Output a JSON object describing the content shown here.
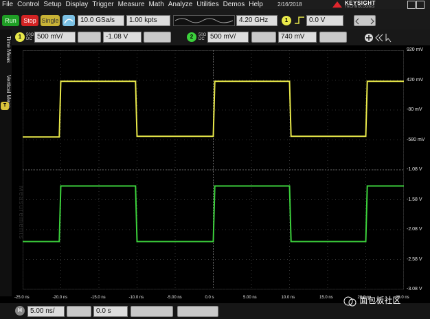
{
  "menu": [
    "File",
    "Control",
    "Setup",
    "Display",
    "Trigger",
    "Measure",
    "Math",
    "Analyze",
    "Utilities",
    "Demos",
    "Help"
  ],
  "date": "2/16/2018",
  "brand": {
    "name": "KEYSIGHT",
    "sub": "TECHNOLOGIES"
  },
  "toolbar": {
    "run": "Run",
    "stop": "Stop",
    "single": "Single",
    "sample_rate": "10.0 GSa/s",
    "memory_depth": "1.00 kpts",
    "bandwidth": "4.20 GHz",
    "trigger_source": "1",
    "trigger_level": "0.0 V"
  },
  "channels": [
    {
      "id": "1",
      "coupling": "50Ω\nDC",
      "scale": "500 mV/",
      "offset": "-1.08 V",
      "color": "#e8e84a"
    },
    {
      "id": "2",
      "coupling": "50Ω\nDC",
      "scale": "500 mV/",
      "offset": "740 mV",
      "color": "#3cd13c"
    }
  ],
  "sidebar": {
    "time_meas": "Time Meas",
    "vertical_meas": "Vertical Meas",
    "measurements": "Measurements"
  },
  "y_axis_labels": [
    "920 mV",
    "420 mV",
    "-80 mV",
    "-580 mV",
    "-1.08 V",
    "-1.58 V",
    "-2.08 V",
    "-2.58 V",
    "-3.08 V"
  ],
  "x_axis_labels": [
    "-25.0 ns",
    "-20.0 ns",
    "-15.0 ns",
    "-10.0 ns",
    "-5.00 ns",
    "0.0 s",
    "5.00 ns",
    "10.0 ns",
    "15.0 ns",
    "20.0 ns",
    "25.0 ns"
  ],
  "horizontal": {
    "badge": "H",
    "scale": "5.00 ns/",
    "delay": "0.0 s"
  },
  "watermark_text": "面包板社区",
  "chart_data": {
    "type": "line",
    "x_unit": "ns",
    "xlim": [
      -25,
      25
    ],
    "series": [
      {
        "channel": "1",
        "color": "#e8e84a",
        "x": [
          -25,
          -20.2,
          -20.0,
          -10.2,
          -10.0,
          0.0,
          0.2,
          10.0,
          10.2,
          20.0,
          20.2,
          25
        ],
        "y": [
          -0.53,
          -0.53,
          0.4,
          0.4,
          -0.52,
          -0.52,
          0.4,
          0.4,
          -0.52,
          -0.52,
          0.4,
          0.4
        ]
      },
      {
        "channel": "2",
        "color": "#3cd13c",
        "x": [
          -25,
          -20.2,
          -20.0,
          -10.2,
          -10.0,
          0.0,
          0.2,
          10.0,
          10.2,
          20.0,
          20.2,
          25
        ],
        "y": [
          -2.28,
          -2.28,
          -1.35,
          -1.35,
          -2.28,
          -2.28,
          -1.35,
          -1.35,
          -2.28,
          -2.28,
          -1.35,
          -1.35
        ]
      }
    ],
    "ylim": [
      -3.08,
      0.92
    ]
  }
}
